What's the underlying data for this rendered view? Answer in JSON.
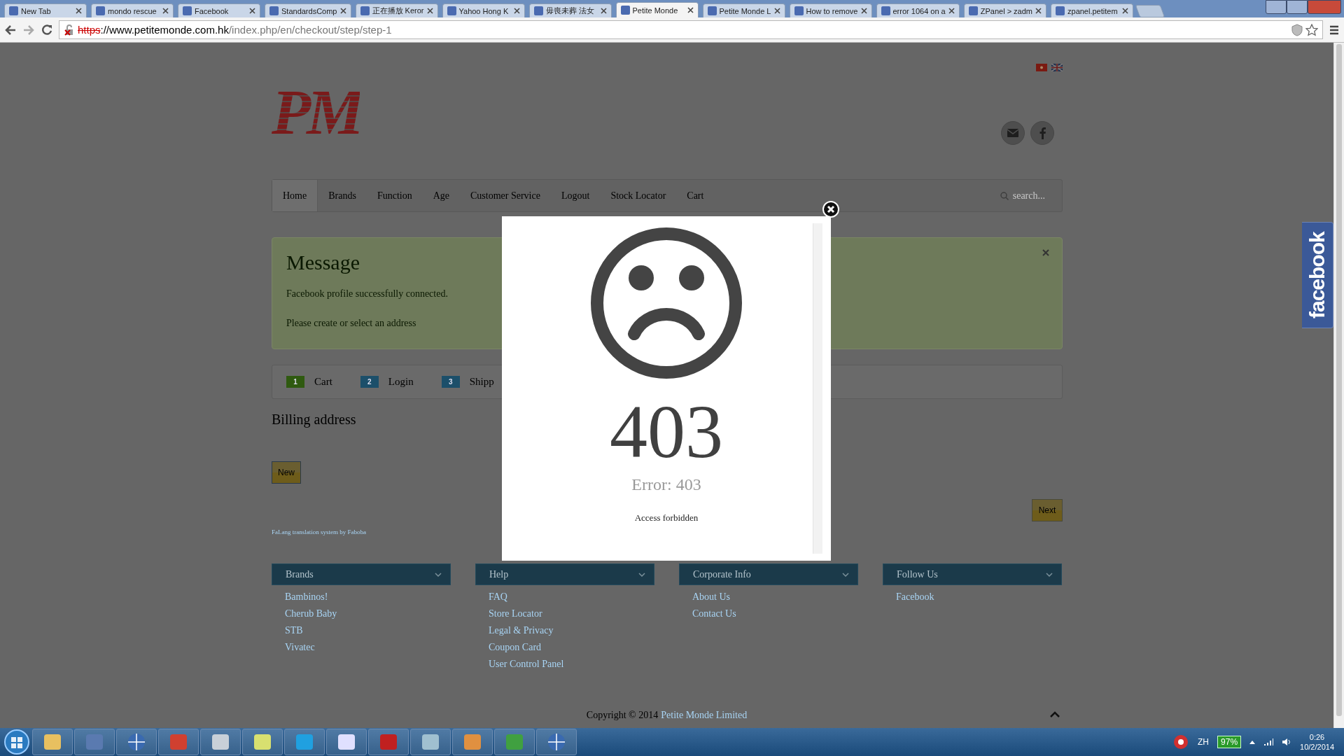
{
  "browser": {
    "tabs": [
      {
        "title": "New Tab",
        "selected": false
      },
      {
        "title": "mondo rescue",
        "selected": false
      },
      {
        "title": "Facebook",
        "selected": false
      },
      {
        "title": "StandardsComp",
        "selected": false
      },
      {
        "title": "正在播放 Keror",
        "selected": false
      },
      {
        "title": "Yahoo Hong K",
        "selected": false
      },
      {
        "title": "毋喪未葬 法女",
        "selected": false
      },
      {
        "title": "Petite Monde",
        "selected": true
      },
      {
        "title": "Petite Monde L",
        "selected": false
      },
      {
        "title": "How to remove",
        "selected": false
      },
      {
        "title": "error 1064 on a",
        "selected": false
      },
      {
        "title": "ZPanel > zadm",
        "selected": false
      },
      {
        "title": "zpanel.petitem",
        "selected": false
      }
    ],
    "address": {
      "scheme": "https",
      "host": "://www.petitemonde.com.hk",
      "path": "/index.php/en/checkout/step/step-1"
    }
  },
  "page": {
    "logo": "PM",
    "nav": [
      {
        "label": "Home",
        "selected": true
      },
      {
        "label": "Brands",
        "selected": false
      },
      {
        "label": "Function",
        "selected": false
      },
      {
        "label": "Age",
        "selected": false
      },
      {
        "label": "Customer Service",
        "selected": false
      },
      {
        "label": "Logout",
        "selected": false
      },
      {
        "label": "Stock Locator",
        "selected": false
      },
      {
        "label": "Cart",
        "selected": false
      }
    ],
    "search": {
      "placeholder": "search..."
    },
    "message": {
      "title": "Message",
      "lines": [
        "Facebook profile successfully connected.",
        "Please create or select an address"
      ]
    },
    "steps": [
      {
        "number": "1",
        "label": "Cart",
        "color": "#2f5a10"
      },
      {
        "number": "2",
        "label": "Login",
        "color": "#1c4f6a"
      },
      {
        "number": "3",
        "label": "Shipp",
        "color": "#1c4f6a"
      }
    ],
    "billing_title": "Billing address",
    "new_button": "New",
    "next_button": "Next",
    "credit": "FaLang translation system by Faboba",
    "footer": [
      {
        "title": "Brands",
        "links": [
          "Bambinos!",
          "Cherub Baby",
          "STB",
          "Vivatec"
        ]
      },
      {
        "title": "Help",
        "links": [
          "FAQ",
          "Store Locator",
          "Legal & Privacy",
          "Coupon Card",
          "User Control Panel"
        ]
      },
      {
        "title": "Corporate Info",
        "links": [
          "About Us",
          "Contact Us"
        ]
      },
      {
        "title": "Follow Us",
        "links": [
          "Facebook"
        ]
      }
    ],
    "copyright": {
      "text": "Copyright © 2014",
      "link": "Petite Monde Limited"
    }
  },
  "modal": {
    "code": "403",
    "title": "Error: 403",
    "message": "Access forbidden"
  },
  "facebook_tab": "facebook",
  "taskbar": {
    "language": "ZH",
    "battery": "97%",
    "time": "0:26",
    "date": "10/2/2014"
  }
}
